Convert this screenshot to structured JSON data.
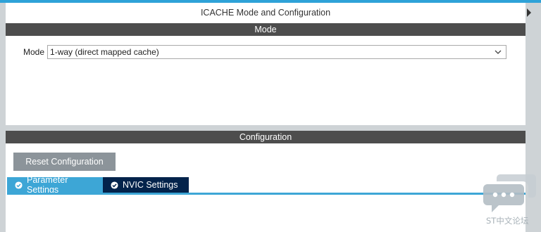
{
  "window": {
    "title": "ICACHE Mode and Configuration"
  },
  "mode_section": {
    "header": "Mode",
    "mode_label": "Mode",
    "mode_value": "1-way (direct mapped cache)"
  },
  "config_section": {
    "header": "Configuration",
    "reset_button": "Reset Configuration",
    "tabs": [
      {
        "label": "Parameter Settings",
        "state": "active"
      },
      {
        "label": "NVIC Settings",
        "state": "selected-dark"
      }
    ]
  },
  "watermark": {
    "text": "ST中文论坛"
  },
  "colors": {
    "accent": "#2ea2d8",
    "header_bg": "#4d4d4d",
    "tab_active": "#3da6d6",
    "tab_dark": "#03234b",
    "button_bg": "#8c949a",
    "background": "#ced3d6"
  },
  "icons": {
    "dropdown": "chevron-down-icon",
    "tab_status": "check-circle-icon",
    "side_panel_toggle": "caret-right-icon",
    "watermark_logo": "chat-bubble-icon"
  }
}
